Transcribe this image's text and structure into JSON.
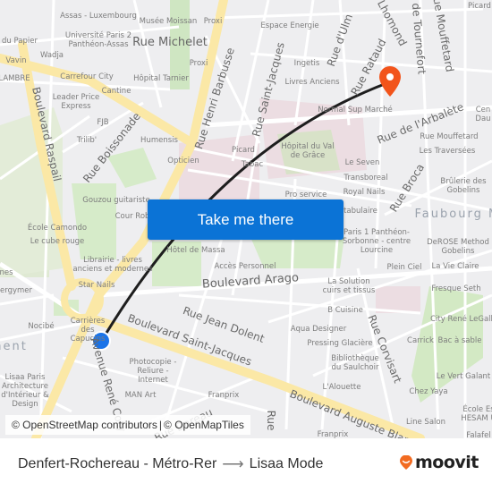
{
  "map": {
    "labels": {
      "poi": [
        "Assas - Luxembourg",
        "Musée Moissan",
        "Proxi",
        "Université Paris 2 Panthéon-Assas",
        "du Papier",
        "Wadja",
        "Vavin",
        "LAMBRE",
        "Carrefour City",
        "Cantine",
        "Hôpital Tarnier",
        "Proxi",
        "Leader Price Express",
        "FJB",
        "Trilib'",
        "Humensis",
        "Opticien",
        "Espace Energie",
        "Ingetis",
        "Livres Anciens",
        "Normal Sup Marché",
        "Picard",
        "Tabac",
        "Hôpital du Val de Grâce",
        "Le Seven",
        "Transboreal",
        "Royal Nails",
        "Pro service",
        "Rue Mouffetard",
        "Les Traversées",
        "Brûlerie des Gobelins",
        "tabulaire",
        "Paris 1 Panthéon-Sorbonne - centre Lourcine",
        "DeROSE Method Gobelins",
        "Plein Ciel",
        "La Vie Claire",
        "Gouzou guitariste",
        "Cour Rob",
        "École Camondo",
        "Le cube rouge",
        "Librairie - livres anciens et modernes",
        "Hôtel de Massa",
        "Accès Personnel",
        "nes",
        "ergymer",
        "Star Nails",
        "Nocibé",
        "Carrières des Capucins",
        "La Solution cuirs et tissus",
        "Fresque Seth",
        "B Cuisine",
        "City René LeGall",
        "Aqua Designer",
        "Pressing Glacière",
        "Carrick",
        "Bac à sable",
        "Bibliothèque du Saulchoir",
        "Le Vert Galant",
        "L'Alouette",
        "Chez Yaya",
        "Photocopie - Reliure - Internet",
        "MAN Art",
        "Franprix",
        "Lisaa Paris Architecture d'Intérieur & Design",
        "École Es HESAM U",
        "Line Salon",
        "Franprix",
        "Falafel",
        "Picard",
        "Cen Dau"
      ],
      "streets": [
        "Rue Michelet",
        "Boulevard Raspail",
        "Rue Boissonade",
        "Rue Henri Barbusse",
        "Rue Saint-Jacques",
        "Rue d'Ulm",
        "Rue Rataud",
        "Rue Lhomond",
        "Rue de Tournefort",
        "Rue Mouffetard",
        "Rue de l'Arbalète",
        "Rue Broca",
        "Boulevard Arago",
        "Rue Jean Dolent",
        "Boulevard Saint-Jacques",
        "Avenue René Coty",
        "Rue Corvisart",
        "Boulevard Auguste Blanqui",
        "Rue Dareau",
        "Rue"
      ],
      "districts": [
        "Faubourg Mar",
        "nent"
      ]
    },
    "origin_marker": {
      "name": "Denfert-Rochereau - Métro-Rer",
      "color": "#1a73e8"
    },
    "destination_marker": {
      "name": "Lisaa Mode",
      "color": "#f2541b"
    },
    "route_line_color": "#1e1e1e",
    "cta_button": {
      "label": "Take me there",
      "color": "#0b73d6"
    },
    "attribution": {
      "osm": "© OpenStreetMap contributors",
      "separator": "|",
      "omt": "© OpenMapTiles"
    }
  },
  "footer": {
    "origin": "Denfert-Rochereau - Métro-Rer",
    "arrow_icon": "arrow-right-icon",
    "destination": "Lisaa Mode",
    "brand": "moovit",
    "brand_color": "#f26b21"
  }
}
